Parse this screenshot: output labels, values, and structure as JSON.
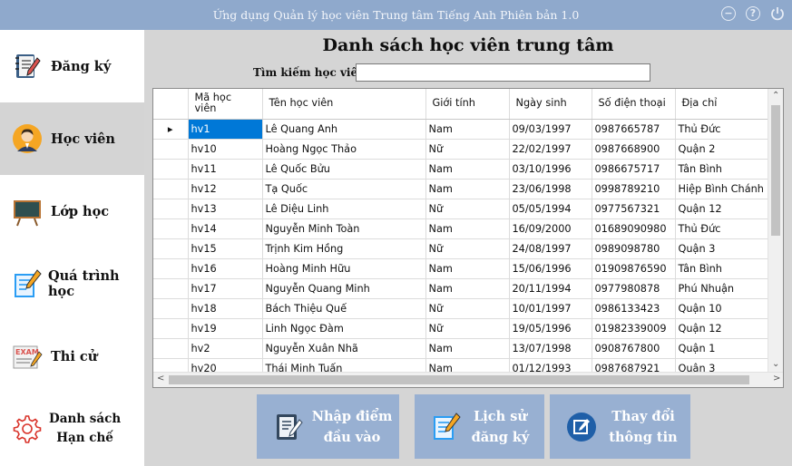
{
  "window": {
    "title": "Ứng dụng Quản lý học viên Trung tâm Tiếng Anh Phiên bản 1.0",
    "minimize_symbol": "−",
    "help_symbol": "?"
  },
  "sidebar": {
    "items": [
      {
        "label": "Đăng ký",
        "icon": "register-notebook-icon"
      },
      {
        "label": "Học viên",
        "icon": "student-icon",
        "active": true
      },
      {
        "label": "Lớp học",
        "icon": "blackboard-icon"
      },
      {
        "label": "Quá trình học",
        "icon": "study-process-icon"
      },
      {
        "label": "Thi cử",
        "icon": "exam-icon"
      },
      {
        "label_line1": "Danh sách",
        "label_line2": "Hạn chế",
        "icon": "gear-icon"
      }
    ]
  },
  "main": {
    "heading": "Danh sách học viên trung tâm",
    "search_label": "Tìm kiếm học viên:",
    "search_value": ""
  },
  "table": {
    "columns": [
      "Mã học viên",
      "Tên học viên",
      "Giới tính",
      "Ngày sinh",
      "Số điện thoại",
      "Địa chỉ"
    ],
    "rows": [
      [
        "hv1",
        "Lê Quang Anh",
        "Nam",
        "09/03/1997",
        "0987665787",
        "Thủ Đức"
      ],
      [
        "hv10",
        "Hoàng Ngọc Thảo",
        "Nữ",
        "22/02/1997",
        "0987668900",
        "Quận 2"
      ],
      [
        "hv11",
        "Lê Quốc Bửu",
        "Nam",
        "03/10/1996",
        "0986675717",
        "Tân Bình"
      ],
      [
        "hv12",
        "Tạ Quốc",
        "Nam",
        "23/06/1998",
        "0998789210",
        "Hiệp Bình Chánh"
      ],
      [
        "hv13",
        "Lê Diệu Linh",
        "Nữ",
        "05/05/1994",
        "0977567321",
        "Quận 12"
      ],
      [
        "hv14",
        "Nguyễn Minh Toàn",
        "Nam",
        "16/09/2000",
        "01689090980",
        "Thủ Đức"
      ],
      [
        "hv15",
        "Trịnh Kim Hồng",
        "Nữ",
        "24/08/1997",
        "0989098780",
        "Quận 3"
      ],
      [
        "hv16",
        "Hoàng Minh Hữu",
        "Nam",
        "15/06/1996",
        "01909876590",
        "Tân Bình"
      ],
      [
        "hv17",
        "Nguyễn Quang Minh",
        "Nam",
        "20/11/1994",
        "0977980878",
        "Phú Nhuận"
      ],
      [
        "hv18",
        "Bách Thiệu Quế",
        "Nữ",
        "10/01/1997",
        "0986133423",
        "Quận 10"
      ],
      [
        "hv19",
        "Linh Ngọc Đàm",
        "Nữ",
        "19/05/1996",
        "01982339009",
        "Quận 12"
      ],
      [
        "hv2",
        "Nguyễn Xuân Nhã",
        "Nam",
        "13/07/1998",
        "0908767800",
        "Quận 1"
      ],
      [
        "hv20",
        "Thái Minh Tuấn",
        "Nam",
        "01/12/1993",
        "0987687921",
        "Quận 3"
      ]
    ],
    "selected_row": 0,
    "current_row_marker": "▸"
  },
  "actions": [
    {
      "line1": "Nhập điểm",
      "line2": "đầu vào",
      "icon": "score-entry-icon"
    },
    {
      "line1": "Lịch sử",
      "line2": "đăng ký",
      "icon": "history-edit-icon"
    },
    {
      "line1": "Thay đổi",
      "line2": "thông tin",
      "icon": "edit-info-icon"
    }
  ],
  "colors": {
    "titlebar": "#8fa9cc",
    "action_button": "#98b0d2",
    "content_bg": "#d5d5d5",
    "active_nav": "#d4d4d4",
    "selection": "#0078d7"
  }
}
